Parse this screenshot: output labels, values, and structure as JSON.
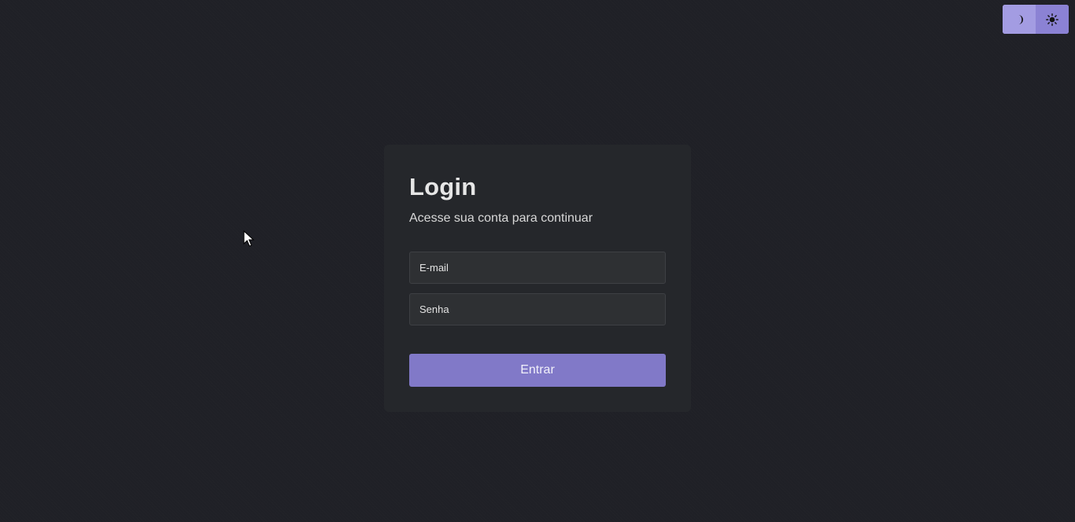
{
  "theme_toggle": {
    "dark_icon": "moon-icon",
    "light_icon": "sun-icon",
    "accent": "#9b93dc"
  },
  "login": {
    "title": "Login",
    "subtitle": "Acesse sua conta para continuar",
    "email_placeholder": "E-mail",
    "password_placeholder": "Senha",
    "submit_label": "Entrar",
    "button_color": "#8179c8"
  }
}
